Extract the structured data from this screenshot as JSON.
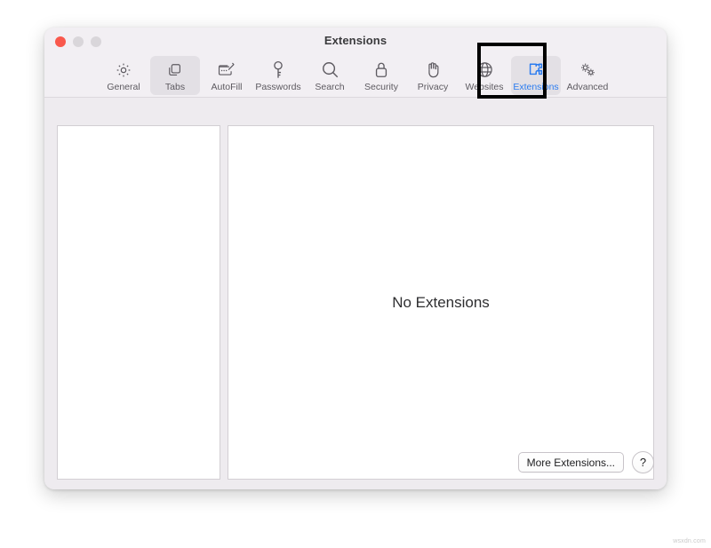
{
  "window": {
    "title": "Extensions",
    "controls": [
      {
        "name": "close",
        "color": "#f9584c"
      },
      {
        "name": "minimize",
        "color": "#d9d6da"
      },
      {
        "name": "maximize",
        "color": "#d9d6da"
      }
    ]
  },
  "toolbar": {
    "items": [
      {
        "label": "General",
        "icon": "gear-icon",
        "selected": false,
        "active": false
      },
      {
        "label": "Tabs",
        "icon": "tabs-icon",
        "selected": true,
        "active": false
      },
      {
        "label": "AutoFill",
        "icon": "autofill-icon",
        "selected": false,
        "active": false
      },
      {
        "label": "Passwords",
        "icon": "key-icon",
        "selected": false,
        "active": false
      },
      {
        "label": "Search",
        "icon": "magnifier-icon",
        "selected": false,
        "active": false
      },
      {
        "label": "Security",
        "icon": "lock-icon",
        "selected": false,
        "active": false
      },
      {
        "label": "Privacy",
        "icon": "hand-icon",
        "selected": false,
        "active": false
      },
      {
        "label": "Websites",
        "icon": "globe-icon",
        "selected": false,
        "active": false
      },
      {
        "label": "Extensions",
        "icon": "puzzle-icon",
        "selected": true,
        "active": true
      },
      {
        "label": "Advanced",
        "icon": "gears-icon",
        "selected": false,
        "active": false
      }
    ],
    "highlighted_item": "Extensions",
    "highlight_color": "#000000",
    "accent_color": "#2b7cf0"
  },
  "main": {
    "extensions_list": [],
    "empty_message": "No Extensions"
  },
  "footer": {
    "more_extensions_label": "More Extensions...",
    "help_label": "?"
  },
  "watermark": {
    "text": "wsxdn.com"
  }
}
